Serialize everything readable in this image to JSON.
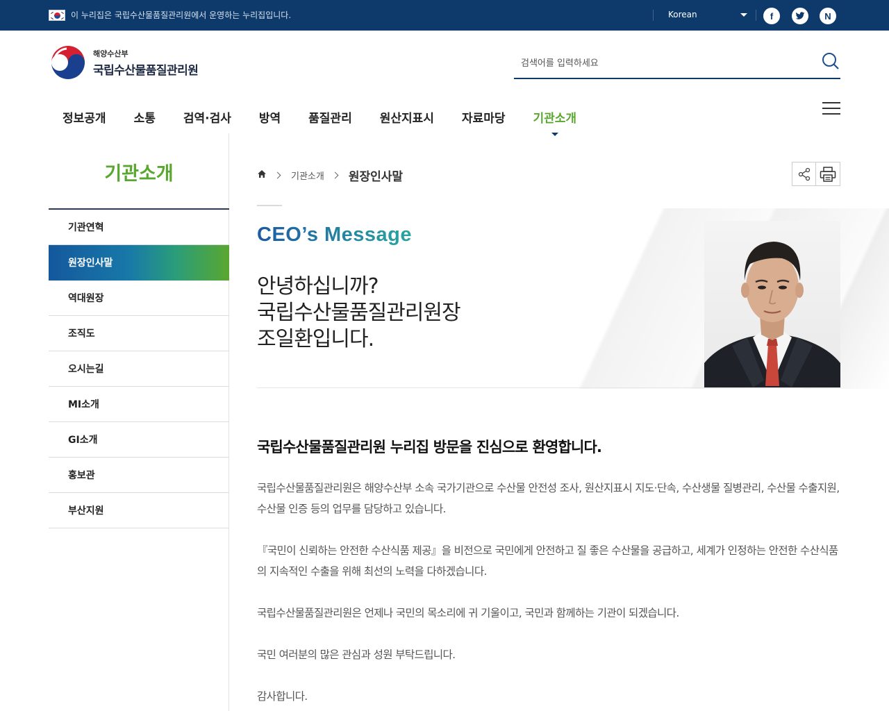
{
  "topbar": {
    "notice": "이 누리집은 국립수산물품질관리원에서 운영하는 누리집입니다.",
    "language": "Korean",
    "sns": [
      {
        "name": "facebook-icon",
        "glyph": "f"
      },
      {
        "name": "twitter-icon",
        "glyph": "t"
      },
      {
        "name": "naver-blog-icon",
        "glyph": "N"
      }
    ]
  },
  "header": {
    "ministry": "해양수산부",
    "org_name": "국립수산물품질관리원",
    "search_placeholder": "검색어를 입력하세요"
  },
  "gnb": {
    "items": [
      "정보공개",
      "소통",
      "검역·검사",
      "방역",
      "품질관리",
      "원산지표시",
      "자료마당",
      "기관소개"
    ],
    "active_index": 7
  },
  "lnb": {
    "title": "기관소개",
    "items": [
      "기관연혁",
      "원장인사말",
      "역대원장",
      "조직도",
      "오시는길",
      "MI소개",
      "GI소개",
      "홍보관",
      "부산지원"
    ],
    "active_index": 1
  },
  "breadcrumb": {
    "level1": "기관소개",
    "current": "원장인사말"
  },
  "hero": {
    "heading": "CEO’s Message",
    "greeting_lines": [
      "안녕하십니까?",
      "국립수산물품질관리원장",
      "조일환입니다."
    ]
  },
  "content": {
    "headline": "국립수산물품질관리원 누리집 방문을 진심으로 환영합니다.",
    "paragraphs": [
      "국립수산물품질관리원은 해양수산부 소속 국가기관으로 수산물 안전성 조사, 원산지표시 지도·단속, 수산생물 질병관리, 수산물 수출지원, 수산물 인증 등의 업무를 담당하고 있습니다.",
      "『국민이 신뢰하는 안전한 수산식품 제공』을 비전으로 국민에게 안전하고 질 좋은 수산물을 공급하고, 세계가 인정하는 안전한 수산식품의 지속적인 수출을 위해 최선의 노력을 다하겠습니다.",
      "국립수산물품질관리원은 언제나 국민의 목소리에 귀 기울이고, 국민과 함께하는 기관이 되겠습니다.",
      "국민 여러분의 많은 관심과 성원 부탁드립니다.",
      "감사합니다."
    ]
  },
  "colors": {
    "navy": "#0d3a6b",
    "green": "#5aa72f",
    "active_gradient_start": "#14589d",
    "active_gradient_end": "#5aa72f"
  }
}
